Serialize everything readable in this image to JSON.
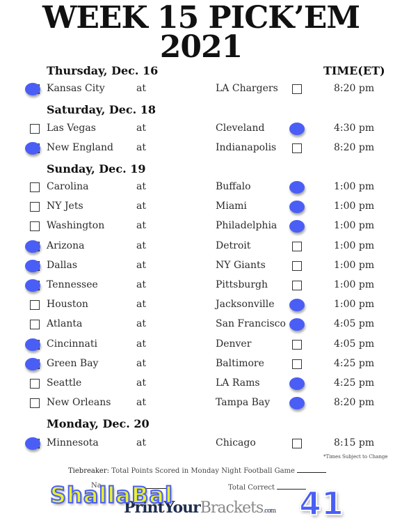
{
  "header": {
    "title_line1": "WEEK 15 PICK’EM",
    "title_line2": "2021",
    "time_header": "TIME(ET)"
  },
  "pick_color": "#4a5ef5",
  "days": [
    {
      "label": "Thursday, Dec. 16",
      "games": [
        {
          "away": "Kansas City",
          "at": "at",
          "home": "LA Chargers",
          "time": "8:20 pm",
          "pick": "away"
        }
      ]
    },
    {
      "label": "Saturday, Dec. 18",
      "games": [
        {
          "away": "Las Vegas",
          "at": "at",
          "home": "Cleveland",
          "time": "4:30 pm",
          "pick": "home"
        },
        {
          "away": "New England",
          "at": "at",
          "home": "Indianapolis",
          "time": "8:20 pm",
          "pick": "away"
        }
      ]
    },
    {
      "label": "Sunday, Dec. 19",
      "games": [
        {
          "away": "Carolina",
          "at": "at",
          "home": "Buffalo",
          "time": "1:00 pm",
          "pick": "home"
        },
        {
          "away": "NY Jets",
          "at": "at",
          "home": "Miami",
          "time": "1:00 pm",
          "pick": "home"
        },
        {
          "away": "Washington",
          "at": "at",
          "home": "Philadelphia",
          "time": "1:00 pm",
          "pick": "home"
        },
        {
          "away": "Arizona",
          "at": "at",
          "home": "Detroit",
          "time": "1:00 pm",
          "pick": "away"
        },
        {
          "away": "Dallas",
          "at": "at",
          "home": "NY Giants",
          "time": "1:00 pm",
          "pick": "away"
        },
        {
          "away": "Tennessee",
          "at": "at",
          "home": "Pittsburgh",
          "time": "1:00 pm",
          "pick": "away"
        },
        {
          "away": "Houston",
          "at": "at",
          "home": "Jacksonville",
          "time": "1:00 pm",
          "pick": "home"
        },
        {
          "away": "Atlanta",
          "at": "at",
          "home": "San Francisco",
          "time": "4:05 pm",
          "pick": "home"
        },
        {
          "away": "Cincinnati",
          "at": "at",
          "home": "Denver",
          "time": "4:05 pm",
          "pick": "away"
        },
        {
          "away": "Green Bay",
          "at": "at",
          "home": "Baltimore",
          "time": "4:25 pm",
          "pick": "away"
        },
        {
          "away": "Seattle",
          "at": "at",
          "home": "LA Rams",
          "time": "4:25 pm",
          "pick": "home"
        },
        {
          "away": "New Orleans",
          "at": "at",
          "home": "Tampa Bay",
          "time": "8:20 pm",
          "pick": "home"
        }
      ]
    },
    {
      "label": "Monday, Dec. 20",
      "games": [
        {
          "away": "Minnesota",
          "at": "at",
          "home": "Chicago",
          "time": "8:15 pm",
          "pick": "away"
        }
      ]
    }
  ],
  "footer": {
    "note": "*Times Subject to Change",
    "tiebreaker_label": "Tiebreaker:",
    "tiebreaker_text": "Total Points Scored in Monday Night Football Game",
    "name_label": "Na",
    "total_label": "Total Correct",
    "logo_part1": "PrintYour",
    "logo_part2": "Brackets",
    "logo_part3": ".com"
  },
  "overlay": {
    "player_name": "ShallaBal",
    "score": "41"
  }
}
